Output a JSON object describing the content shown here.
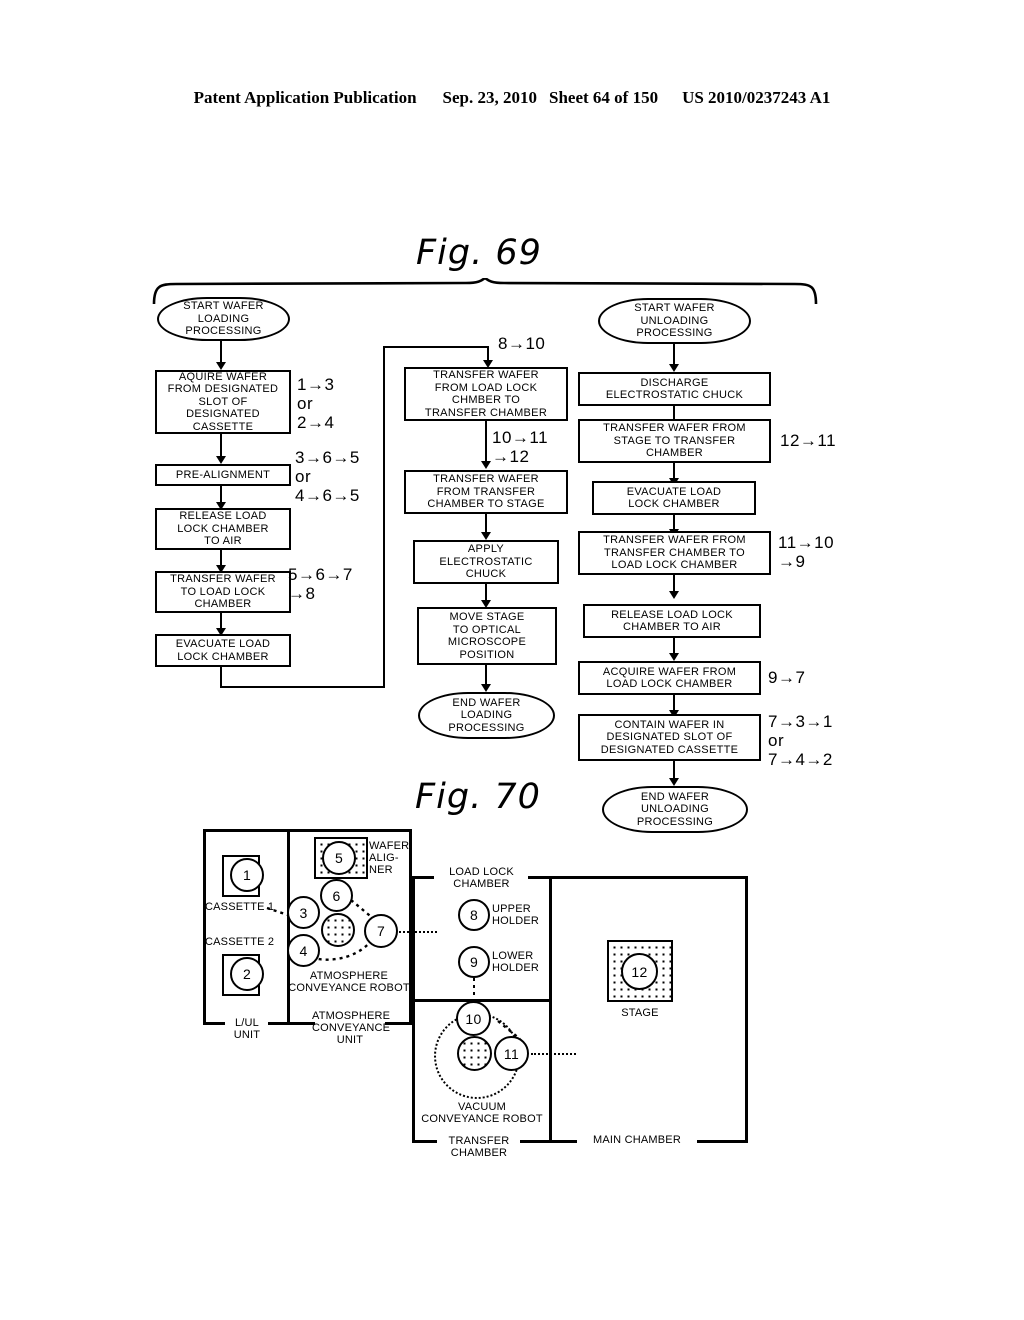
{
  "header": {
    "publication": "Patent Application Publication",
    "date": "Sep. 23, 2010",
    "sheet": "Sheet 64 of 150",
    "docnum": "US 2010/0237243 A1"
  },
  "fig69": {
    "title": "Fig. 69",
    "loading_column": {
      "start": "START WAFER\nLOADING\nPROCESSING",
      "steps": [
        "AQUIRE WAFER\nFROM DESIGNATED\nSLOT OF\nDESIGNATED\nCASSETTE",
        "PRE-ALIGNMENT",
        "RELEASE LOAD\nLOCK CHAMBER\nTO AIR",
        "TRANSFER WAFER\nTO LOAD LOCK\nCHAMBER",
        "EVACUATE LOAD\nLOCK CHAMBER"
      ],
      "annotations": [
        "1→3\nor\n2→4",
        "3→6→5\nor\n4→6→5",
        "5→6→7\n→8"
      ]
    },
    "middle_column": {
      "annotations": [
        "8→10",
        "10→11\n→12"
      ],
      "steps": [
        "TRANSFER WAFER\nFROM LOAD LOCK\nCHMBER TO\nTRANSFER CHAMBER",
        "TRANSFER WAFER\nFROM TRANSFER\nCHAMBER TO STAGE",
        "APPLY\nELECTROSTATIC\nCHUCK",
        "MOVE STAGE\nTO OPTICAL\nMICROSCOPE\nPOSITION"
      ],
      "end": "END WAFER\nLOADING\nPROCESSING"
    },
    "unloading_column": {
      "start": "START WAFER\nUNLOADING\nPROCESSING",
      "steps": [
        "DISCHARGE\nELECTROSTATIC CHUCK",
        "TRANSFER WAFER FROM\nSTAGE TO TRANSFER\nCHAMBER",
        "EVACUATE LOAD\nLOCK CHAMBER",
        "TRANSFER WAFER FROM\nTRANSFER CHAMBER TO\nLOAD LOCK CHAMBER",
        "RELEASE LOAD LOCK\nCHAMBER TO AIR",
        "ACQUIRE WAFER FROM\nLOAD LOCK CHAMBER",
        "CONTAIN WAFER IN\nDESIGNATED SLOT OF\nDESIGNATED CASSETTE"
      ],
      "annotations": [
        "12→11",
        "11→10\n→9",
        "9→7",
        "7→3→1\nor\n7→4→2"
      ],
      "end": "END WAFER\nUNLOADING\nPROCESSING"
    }
  },
  "fig70": {
    "title": "Fig. 70",
    "units": {
      "lul_unit": "L/UL\nUNIT",
      "atmosphere_conveyance_unit": "ATMOSPHERE\nCONVEYANCE\nUNIT",
      "load_lock_chamber": "LOAD LOCK\nCHAMBER",
      "transfer_chamber": "TRANSFER\nCHAMBER",
      "main_chamber": "MAIN CHAMBER"
    },
    "labels": {
      "cassette1": "CASSETTE 1",
      "cassette2": "CASSETTE 2",
      "wafer_aligner": "WAFER\nALIG-\nNER",
      "atmosphere_conveyance_robot": "ATMOSPHERE\nCONVEYANCE ROBOT",
      "vacuum_conveyance_robot": "VACUUM\nCONVEYANCE ROBOT",
      "upper_holder": "UPPER\nHOLDER",
      "lower_holder": "LOWER\nHOLDER",
      "stage": "STAGE"
    },
    "positions": {
      "p1": "1",
      "p2": "2",
      "p3": "3",
      "p4": "4",
      "p5": "5",
      "p6": "6",
      "p7": "7",
      "p8": "8",
      "p9": "9",
      "p10": "10",
      "p11": "11",
      "p12": "12"
    }
  }
}
